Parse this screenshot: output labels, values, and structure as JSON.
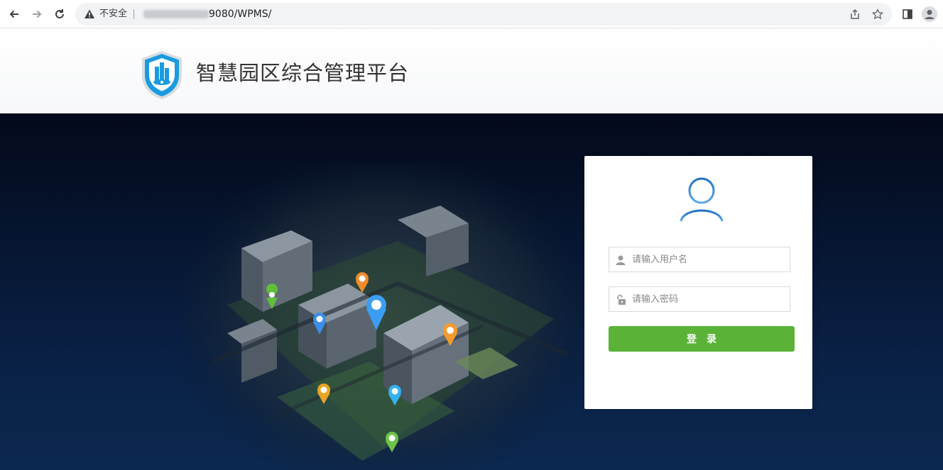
{
  "browser": {
    "security_label": "不安全",
    "url_tail": "9080/WPMS/",
    "icons": [
      "back-icon",
      "forward-icon",
      "reload-icon",
      "warning-icon",
      "share-icon",
      "star-icon",
      "sidepanel-icon",
      "profile-icon"
    ]
  },
  "header": {
    "title": "智慧园区综合管理平台"
  },
  "login": {
    "username_placeholder": "请输入用户名",
    "password_placeholder": "请输入密码",
    "submit_label": "登录"
  },
  "colors": {
    "accent_green": "#5ab336",
    "hero_dark": "#03091a",
    "logo_blue": "#1a9be0"
  }
}
